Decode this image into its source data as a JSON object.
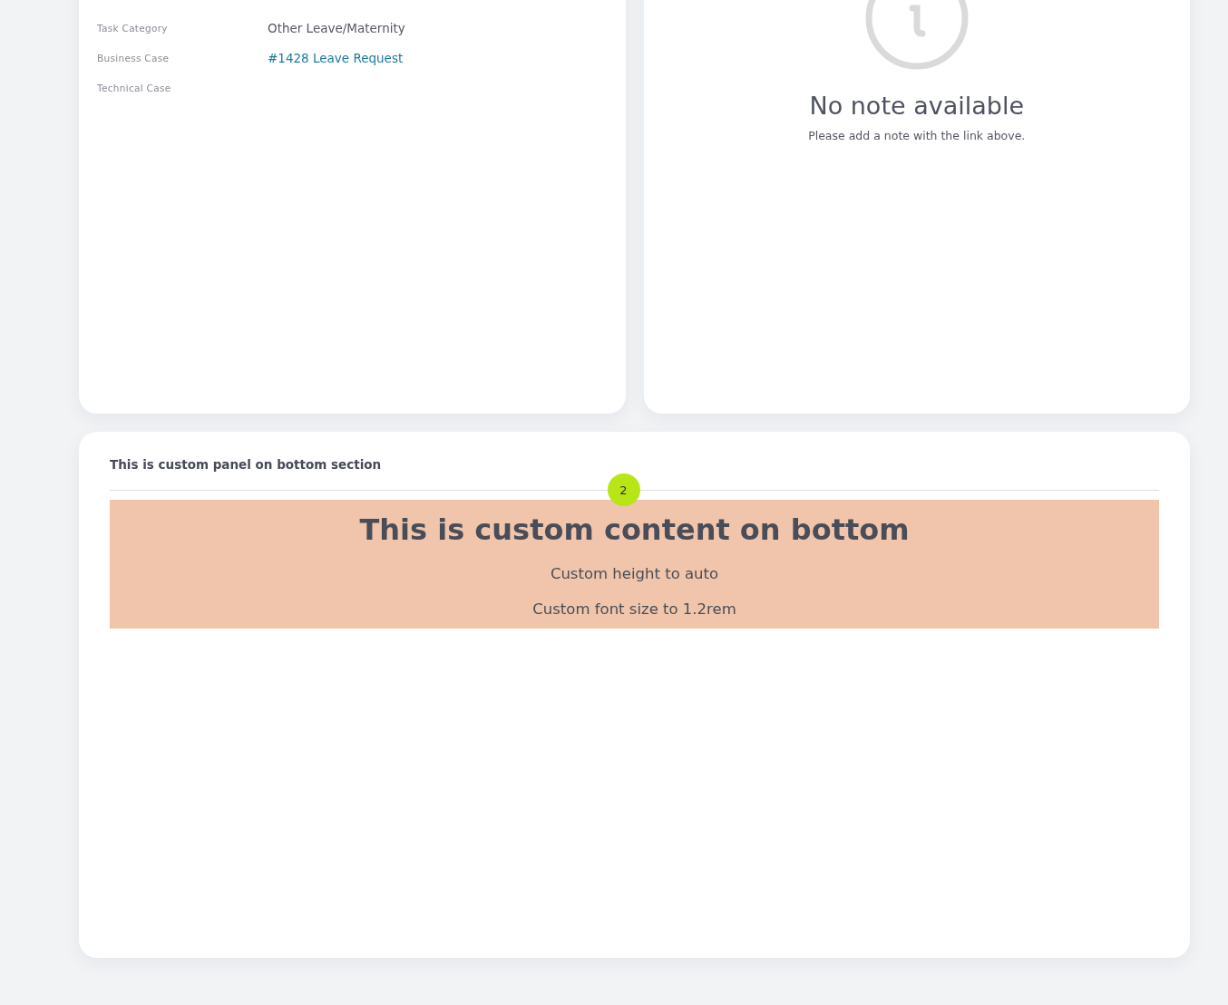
{
  "details": {
    "fields": [
      {
        "label": "Task Category",
        "value": "Other Leave/Maternity",
        "kind": "text"
      },
      {
        "label": "Business Case",
        "value": "#1428 Leave Request",
        "kind": "link"
      },
      {
        "label": "Technical Case"
      }
    ]
  },
  "notes": {
    "empty_title": "No note available",
    "empty_message": "Please add a note with the link above."
  },
  "bottom_panel": {
    "title": "This is custom panel on bottom section",
    "step_badge": "2",
    "content": {
      "heading": "This is custom content on bottom",
      "lines": [
        "Custom height to auto",
        "Custom font size to 1.2rem"
      ]
    }
  }
}
